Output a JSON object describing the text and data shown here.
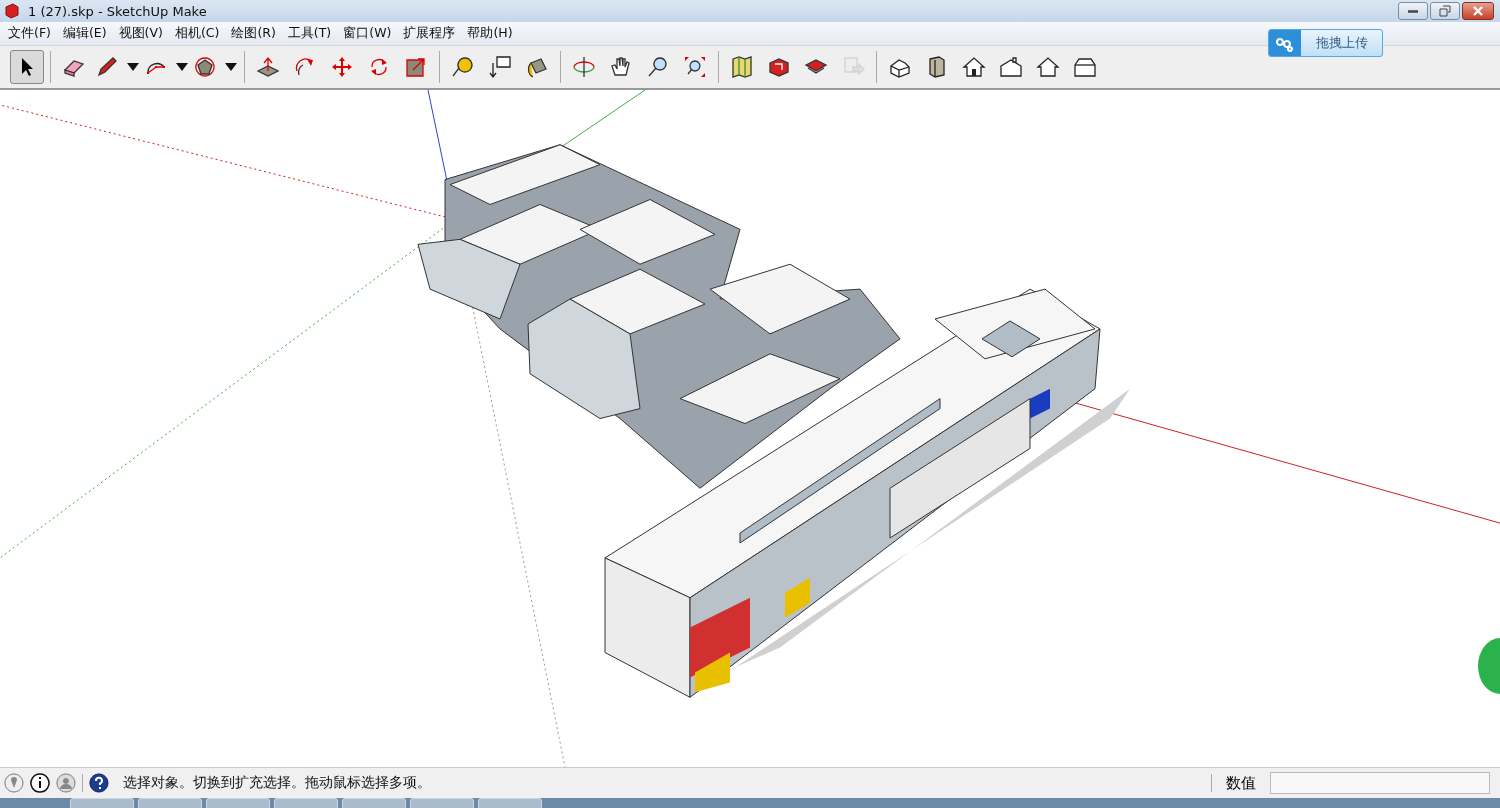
{
  "window": {
    "title": "1 (27).skp - SketchUp Make"
  },
  "menu": [
    "文件(F)",
    "编辑(E)",
    "视图(V)",
    "相机(C)",
    "绘图(R)",
    "工具(T)",
    "窗口(W)",
    "扩展程序",
    "帮助(H)"
  ],
  "upload_button": {
    "label": "拖拽上传"
  },
  "toolbar": {
    "groups": [
      {
        "tools": [
          {
            "selected": true,
            "dropdown": false,
            "disabled": false
          }
        ]
      },
      {
        "tools": [
          {
            "selected": false,
            "dropdown": false,
            "disabled": false
          },
          {
            "selected": false,
            "dropdown": true,
            "disabled": false
          },
          {
            "selected": false,
            "dropdown": true,
            "disabled": false
          },
          {
            "selected": false,
            "dropdown": true,
            "disabled": false
          }
        ]
      },
      {
        "tools": [
          {
            "selected": false,
            "dropdown": false,
            "disabled": false
          },
          {
            "selected": false,
            "dropdown": false,
            "disabled": false
          },
          {
            "selected": false,
            "dropdown": false,
            "disabled": false
          },
          {
            "selected": false,
            "dropdown": false,
            "disabled": false
          },
          {
            "selected": false,
            "dropdown": false,
            "disabled": false
          }
        ]
      },
      {
        "tools": [
          {
            "selected": false,
            "dropdown": false,
            "disabled": false
          },
          {
            "selected": false,
            "dropdown": false,
            "disabled": false
          },
          {
            "selected": false,
            "dropdown": false,
            "disabled": false
          }
        ]
      },
      {
        "tools": [
          {
            "selected": false,
            "dropdown": false,
            "disabled": false
          },
          {
            "selected": false,
            "dropdown": false,
            "disabled": false
          },
          {
            "selected": false,
            "dropdown": false,
            "disabled": false
          },
          {
            "selected": false,
            "dropdown": false,
            "disabled": false
          }
        ]
      },
      {
        "tools": [
          {
            "selected": false,
            "dropdown": false,
            "disabled": false
          },
          {
            "selected": false,
            "dropdown": false,
            "disabled": false
          },
          {
            "selected": false,
            "dropdown": false,
            "disabled": false
          },
          {
            "selected": false,
            "dropdown": false,
            "disabled": true
          }
        ]
      },
      {
        "tools": [
          {
            "selected": false,
            "dropdown": false,
            "disabled": false
          },
          {
            "selected": false,
            "dropdown": false,
            "disabled": false
          },
          {
            "selected": false,
            "dropdown": false,
            "disabled": false
          },
          {
            "selected": false,
            "dropdown": false,
            "disabled": false
          },
          {
            "selected": false,
            "dropdown": false,
            "disabled": false
          },
          {
            "selected": false,
            "dropdown": false,
            "disabled": false
          }
        ]
      }
    ]
  },
  "status_bar": {
    "message": "选择对象。切换到扩充选择。拖动鼠标选择多项。",
    "measurement_label": "数值"
  }
}
